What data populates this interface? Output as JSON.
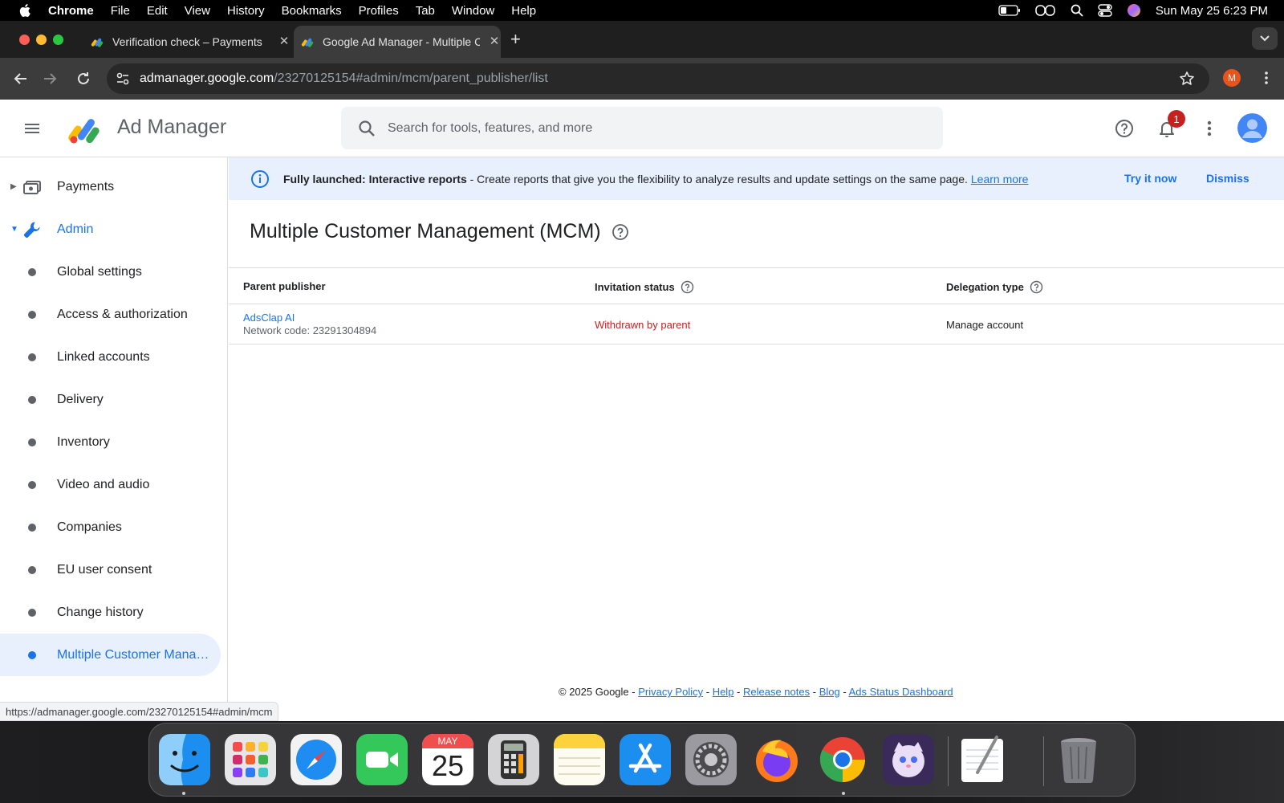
{
  "menubar": {
    "app": "Chrome",
    "items": [
      "File",
      "Edit",
      "View",
      "History",
      "Bookmarks",
      "Profiles",
      "Tab",
      "Window",
      "Help"
    ],
    "clock": "Sun May 25  6:23 PM"
  },
  "browser": {
    "tabs": [
      {
        "title": "Verification check – Payments",
        "active": false
      },
      {
        "title": "Google Ad Manager - Multiple Customer Management",
        "active": true
      }
    ],
    "url_host": "admanager.google.com",
    "url_path": "/23270125154#admin/mcm/parent_publisher/list",
    "profile_initial": "M",
    "status_url": "https://admanager.google.com/23270125154#admin/mcm"
  },
  "appbar": {
    "product": "Ad Manager",
    "search_placeholder": "Search for tools, features, and more",
    "notification_count": "1"
  },
  "sidebar": {
    "sections": [
      {
        "label": "Payments",
        "expanded": false
      },
      {
        "label": "Admin",
        "expanded": true
      }
    ],
    "items": [
      "Global settings",
      "Access & authorization",
      "Linked accounts",
      "Delivery",
      "Inventory",
      "Video and audio",
      "Companies",
      "EU user consent",
      "Change history",
      "Multiple Customer Management"
    ],
    "active_item": "Multiple Customer Management"
  },
  "banner": {
    "bold": "Fully launched: Interactive reports",
    "text": " - Create reports that give you the flexibility to analyze results and update settings on the same page.",
    "learn_more": "Learn more",
    "try_it": "Try it now",
    "dismiss": "Dismiss"
  },
  "main": {
    "title": "Multiple Customer Management (MCM)",
    "columns": [
      "Parent publisher",
      "Invitation status",
      "Delegation type"
    ],
    "rows": [
      {
        "publisher": "AdsClap AI",
        "network_code": "Network code: 23291304894",
        "status": "Withdrawn by parent",
        "delegation": "Manage account"
      }
    ]
  },
  "footer": {
    "copyright": "© 2025 Google - ",
    "links": [
      "Privacy Policy",
      "Help",
      "Release notes",
      "Blog",
      "Ads Status Dashboard"
    ]
  },
  "dock": {
    "calendar_month": "MAY",
    "calendar_day": "25"
  },
  "colors": {
    "accent": "#1a73e8",
    "status_withdrawn": "#c5221f",
    "banner_bg": "#e8f0fe",
    "active_nav_bg": "#e8f0fe"
  }
}
